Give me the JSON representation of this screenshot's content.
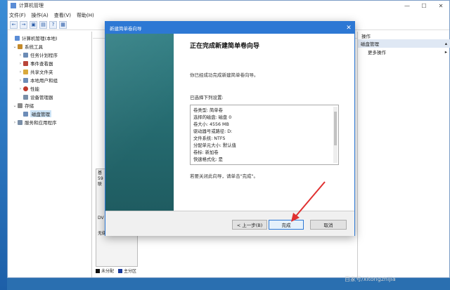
{
  "window": {
    "title": "计算机管理",
    "controls": [
      "—",
      "☐",
      "✕"
    ]
  },
  "menu": [
    "文件(F)",
    "操作(A)",
    "查看(V)",
    "帮助(H)"
  ],
  "toolbar": {
    "buttons": [
      "←",
      "→",
      "▣",
      "▤",
      "?",
      "▦"
    ]
  },
  "tree": {
    "items": [
      {
        "label": "计算机管理(本地)",
        "level": 0,
        "exp": "",
        "color": "#5b8dd6"
      },
      {
        "label": "系统工具",
        "level": 1,
        "exp": "⌄",
        "color": "#c48a2a"
      },
      {
        "label": "任务计划程序",
        "level": 2,
        "exp": "›",
        "color": "#6b8bb5"
      },
      {
        "label": "事件查看器",
        "level": 2,
        "exp": "›",
        "color": "#b9453a"
      },
      {
        "label": "共享文件夹",
        "level": 2,
        "exp": "›",
        "color": "#d9a93c"
      },
      {
        "label": "本地用户和组",
        "level": 2,
        "exp": "›",
        "color": "#6d8db8"
      },
      {
        "label": "性能",
        "level": 2,
        "exp": "›",
        "color": "#c0392b"
      },
      {
        "label": "设备管理器",
        "level": 2,
        "exp": "",
        "color": "#7a8fa8"
      },
      {
        "label": "存储",
        "level": 1,
        "exp": "⌄",
        "color": "#8a8a8a"
      },
      {
        "label": "磁盘管理",
        "level": 2,
        "exp": "",
        "color": "#6d8db8",
        "selected": true
      },
      {
        "label": "服务和应用程序",
        "level": 1,
        "exp": "›",
        "color": "#7a8fa8"
      }
    ]
  },
  "center": {
    "disk_fragments": [
      "基",
      "59",
      "联"
    ],
    "disk_label": "DV",
    "disk_media": "无媒",
    "legend": {
      "unallocated": "未分配",
      "primary": "主分区"
    }
  },
  "actions": {
    "header": "操作",
    "section": "磁盘管理",
    "more": "更多操作"
  },
  "dialog": {
    "title": "新建简单卷向导",
    "heading": "正在完成新建简单卷向导",
    "intro": "你已经成功完成新建简单卷向导。",
    "list_label": "已选择下列设置:",
    "summary": [
      "卷类型: 简单卷",
      "选择的磁盘: 磁盘 0",
      "卷大小: 4556 MB",
      "驱动器号或路径: D:",
      "文件系统: NTFS",
      "分配单元大小: 默认值",
      "卷标: 新加卷",
      "快速格式化: 是"
    ],
    "close_text": "若要关闭此向导，请单击\"完成\"。",
    "back_button": "< 上一步(B)",
    "finish_button": "完成",
    "cancel_button": "取消"
  },
  "watermark": "百家号/xitongzhijia",
  "colors": {
    "accent": "#2d78d4",
    "arrow": "#e03030",
    "side_panel": "#2a7278"
  }
}
